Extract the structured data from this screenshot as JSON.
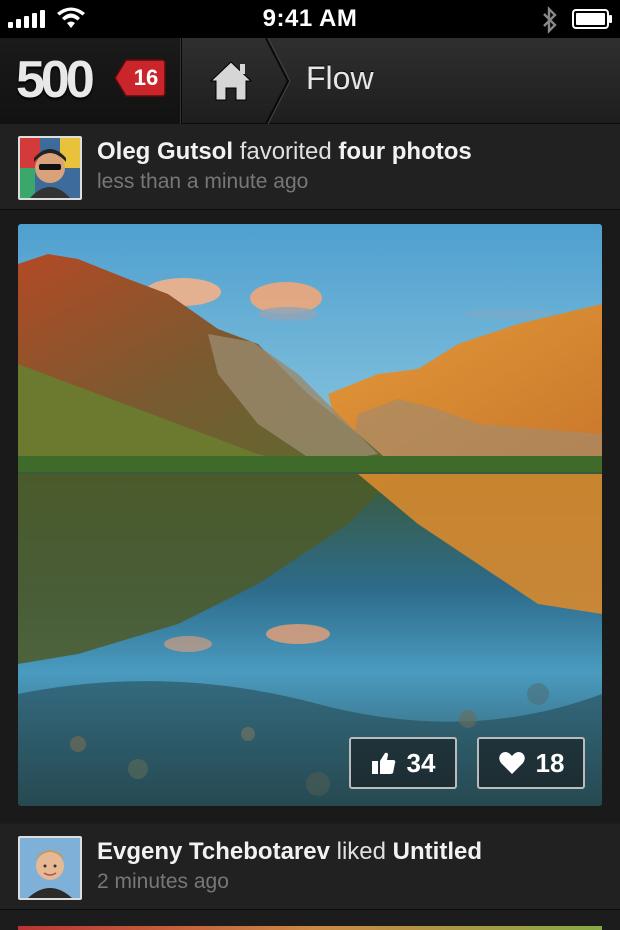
{
  "status_bar": {
    "time": "9:41 AM"
  },
  "header": {
    "logo_text": "500",
    "badge_count": "16",
    "title": "Flow"
  },
  "feed": [
    {
      "user": "Oleg Gutsol",
      "action": "favorited",
      "object": "four photos",
      "time": "less than a minute ago"
    },
    {
      "user": "Evgeny Tchebotarev",
      "action": "liked",
      "object": "Untitled",
      "time": "2 minutes ago"
    }
  ],
  "photo": {
    "likes": "34",
    "favorites": "18"
  },
  "colors": {
    "badge_red": "#c9252b",
    "background": "#1c1c1c"
  }
}
